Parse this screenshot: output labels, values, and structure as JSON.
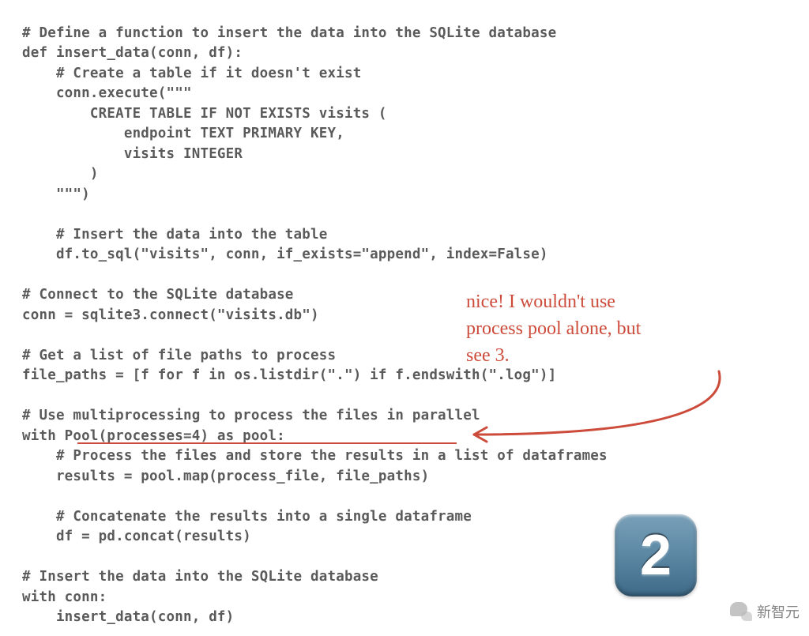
{
  "code": {
    "lines": [
      "# Define a function to insert the data into the SQLite database",
      "def insert_data(conn, df):",
      "    # Create a table if it doesn't exist",
      "    conn.execute(\"\"\"",
      "        CREATE TABLE IF NOT EXISTS visits (",
      "            endpoint TEXT PRIMARY KEY,",
      "            visits INTEGER",
      "        )",
      "    \"\"\")",
      "",
      "    # Insert the data into the table",
      "    df.to_sql(\"visits\", conn, if_exists=\"append\", index=False)",
      "",
      "# Connect to the SQLite database",
      "conn = sqlite3.connect(\"visits.db\")",
      "",
      "# Get a list of file paths to process",
      "file_paths = [f for f in os.listdir(\".\") if f.endswith(\".log\")]",
      "",
      "# Use multiprocessing to process the files in parallel",
      "with Pool(processes=4) as pool:",
      "    # Process the files and store the results in a list of dataframes",
      "    results = pool.map(process_file, file_paths)",
      "",
      "    # Concatenate the results into a single dataframe",
      "    df = pd.concat(results)",
      "",
      "# Insert the data into the SQLite database",
      "with conn:",
      "    insert_data(conn, df)"
    ]
  },
  "annotation": {
    "line1": "nice! I wouldn't use",
    "line2": "process pool alone, but",
    "line3": "see 3."
  },
  "badge": {
    "number": "2",
    "color": "#5e8aa6"
  },
  "watermark": {
    "text": "新智元"
  },
  "colors": {
    "code": "#5a5a5a",
    "annotation": "#cc4b3a"
  }
}
